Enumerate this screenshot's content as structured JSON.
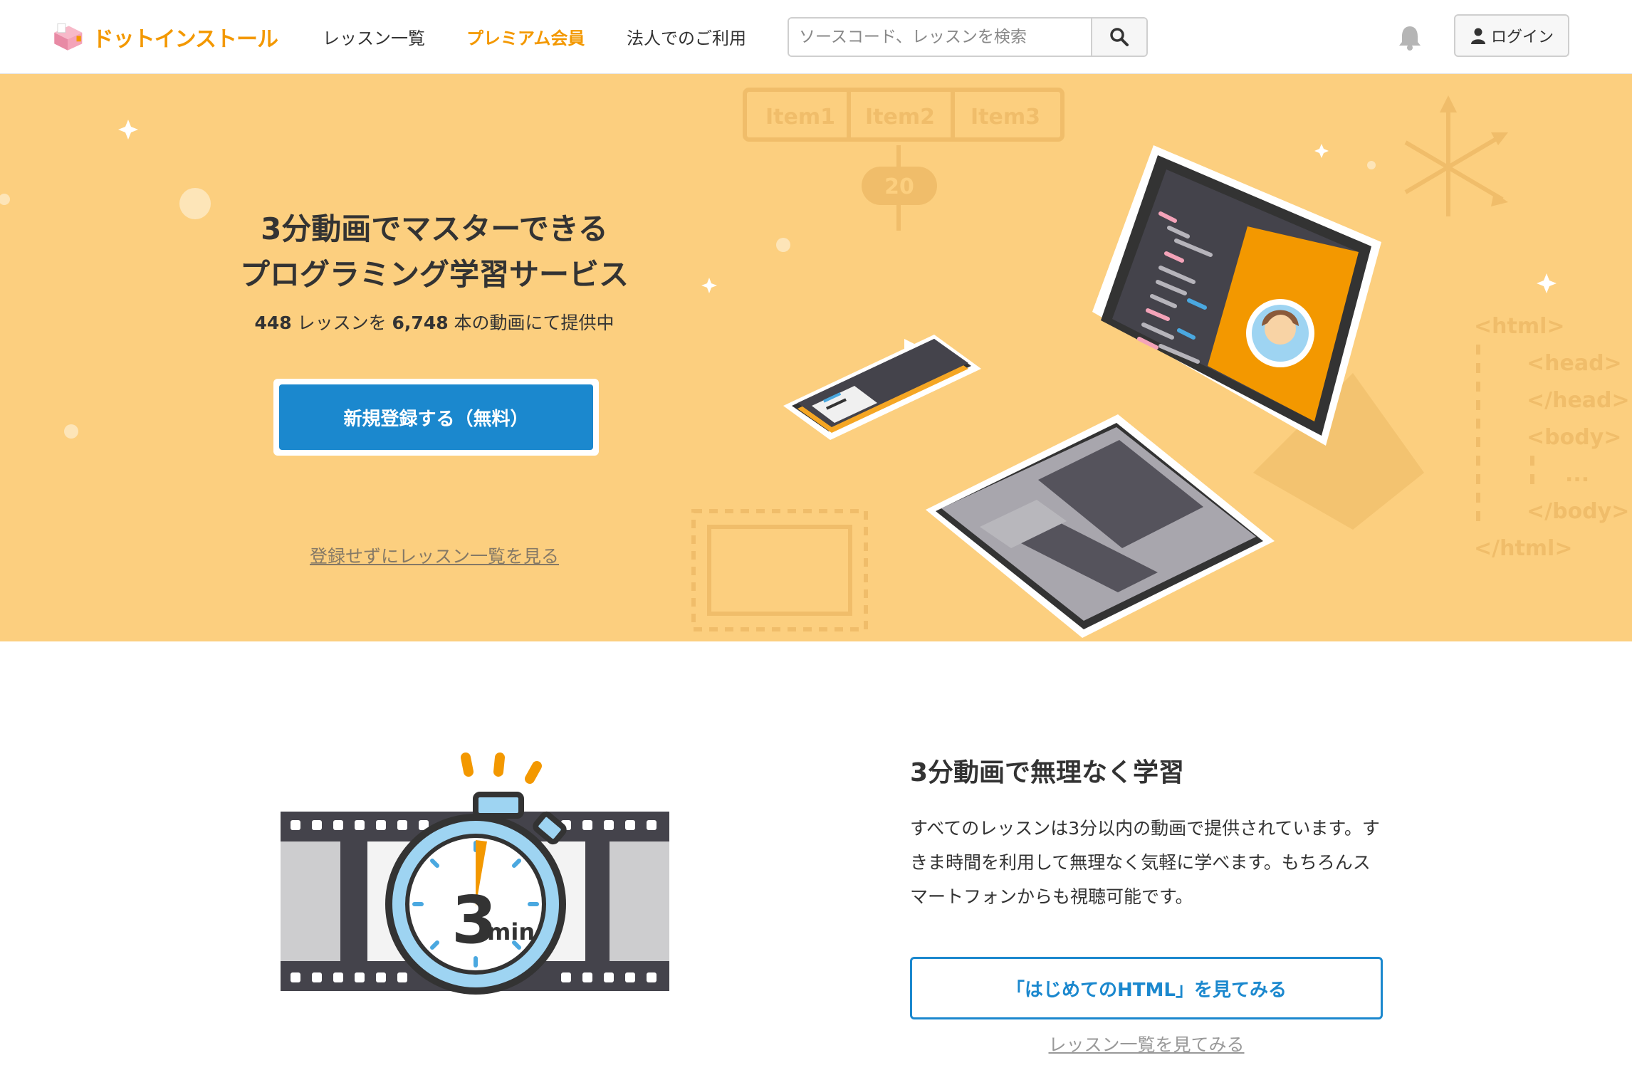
{
  "header": {
    "logo_text": "ドットインストール",
    "nav": [
      {
        "label": "レッスン一覧"
      },
      {
        "label": "プレミアム会員"
      },
      {
        "label": "法人でのご利用"
      }
    ],
    "search_placeholder": "ソースコード、レッスンを検索",
    "login_label": "ログイン"
  },
  "hero": {
    "title_line1": "3分動画でマスターできる",
    "title_line2": "プログラミング学習サービス",
    "lesson_count": "448",
    "lesson_suffix": " レッスンを ",
    "video_count": "6,748",
    "video_suffix": " 本の動画にて提供中",
    "cta_label": "新規登録する（無料）",
    "browse_link": "登録せずにレッスン一覧を見る",
    "art": {
      "tabs": [
        "Item1",
        "Item2",
        "Item3"
      ],
      "badge": "20",
      "code_lines": [
        "<html>",
        "<head>",
        "</head>",
        "<body>",
        "...",
        "</body>",
        "</html>"
      ]
    }
  },
  "feature": {
    "title": "3分動画で無理なく学習",
    "description": "すべてのレッスンは3分以内の動画で提供されています。すきま時間を利用して無理なく気軽に学べます。もちろんスマートフォンからも視聴可能です。",
    "button_label": "「はじめてのHTML」を見てみる",
    "link_label": "レッスン一覧を見てみる",
    "stopwatch_number": "3",
    "stopwatch_unit": "min"
  },
  "colors": {
    "accent_orange": "#f39800",
    "hero_bg": "#fccf7f",
    "primary_blue": "#1b88ce"
  }
}
